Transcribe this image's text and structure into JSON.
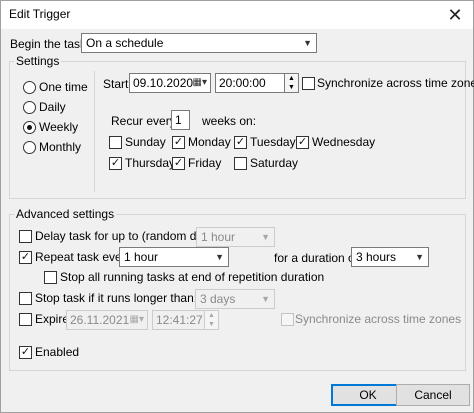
{
  "window": {
    "title": "Edit Trigger",
    "close_icon": "close-icon"
  },
  "begin": {
    "label": "Begin the task:",
    "value": "On a schedule"
  },
  "settings": {
    "label": "Settings",
    "radios": [
      "One time",
      "Daily",
      "Weekly",
      "Monthly"
    ],
    "selected": "Weekly",
    "start_label": "Start:",
    "start_date": "09.10.2020",
    "start_time": "20:00:00",
    "sync_label": "Synchronize across time zones",
    "recur_label": "Recur every:",
    "recur_value": "1",
    "weeks_on_label": "weeks on:",
    "days": {
      "sunday": "Sunday",
      "monday": "Monday",
      "tuesday": "Tuesday",
      "wednesday": "Wednesday",
      "thursday": "Thursday",
      "friday": "Friday",
      "saturday": "Saturday"
    },
    "checked_days": [
      "Monday",
      "Tuesday",
      "Wednesday",
      "Thursday",
      "Friday"
    ]
  },
  "advanced": {
    "label": "Advanced settings",
    "delay_label": "Delay task for up to (random delay):",
    "delay_value": "1 hour",
    "repeat_label": "Repeat task every:",
    "repeat_value": "1 hour",
    "duration_label": "for a duration of:",
    "duration_value": "3 hours",
    "stop_running_label": "Stop all running tasks at end of repetition duration",
    "stop_longer_label": "Stop task if it runs longer than:",
    "stop_longer_value": "3 days",
    "expire_label": "Expire:",
    "expire_date": "26.11.2021",
    "expire_time": "12:41:27",
    "expire_sync_label": "Synchronize across time zones",
    "enabled_label": "Enabled"
  },
  "buttons": {
    "ok": "OK",
    "cancel": "Cancel"
  },
  "colors": {
    "accent": "#0078d7",
    "background": "#f0f0f0"
  }
}
